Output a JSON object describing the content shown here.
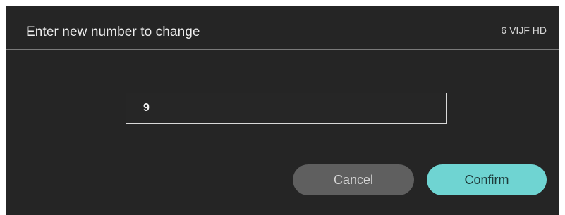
{
  "dialog": {
    "title": "Enter new number to change",
    "channel_name": "6 VIJF HD",
    "input": {
      "value": "9"
    },
    "buttons": {
      "cancel_label": "Cancel",
      "confirm_label": "Confirm"
    }
  },
  "colors": {
    "background": "#252525",
    "accent": "#6fd4d2",
    "cancel_button": "#5f5f5f"
  }
}
